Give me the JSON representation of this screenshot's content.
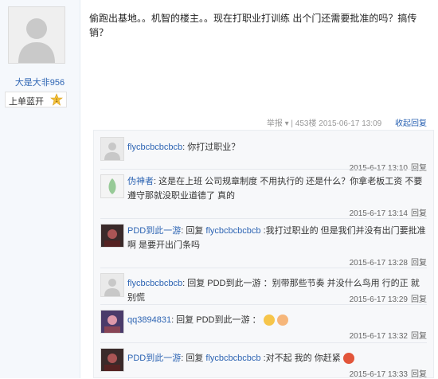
{
  "user": {
    "name": "大是大非956",
    "level_label": "上单蓝开"
  },
  "post": {
    "text": "偷跑出基地。。机智的楼主。。现在打职业打训练 出个门还需要批准的吗？搞传销？"
  },
  "meta": {
    "info": "举报 ▾ | 453楼  2015-06-17 13:09",
    "reply_label": "收起回复"
  },
  "replies": [
    {
      "user": "flycbcbcbcbcb",
      "sep": ":",
      "text": " 你打过职业？",
      "time": "2015-6-17 13:10",
      "reply_btn": "回复"
    },
    {
      "user": "伪神者",
      "sep": ":",
      "text": " 这是在上班 公司规章制度 不用执行的 还是什么？你拿老板工资 不要遵守那就没职业道德了 真的",
      "time": "2015-6-17 13:14",
      "reply_btn": "回复"
    },
    {
      "user": "PDD到此一游",
      "sep": ":",
      "prefix": " 回复 ",
      "target": "flycbcbcbcbcb",
      "text": " :我打过职业的 但是我们并没有出门要批准啊 是要开出门条吗",
      "time": "2015-6-17 13:28",
      "reply_btn": "回复"
    },
    {
      "user": "flycbcbcbcbcb",
      "sep": ":",
      "prefix": " 回复 ",
      "target_plain": "PDD到此一游",
      "text": " ：别带那些节奏 并没什么鸟用 行的正 就别慌",
      "time": "2015-6-17 13:29",
      "reply_btn": "回复"
    },
    {
      "user": "qq3894831",
      "sep": ":",
      "prefix": " 回复 ",
      "target_plain": "PDD到此一游",
      "text": " ：",
      "time": "2015-6-17 13:32",
      "reply_btn": "回复"
    },
    {
      "user": "PDD到此一游",
      "sep": ":",
      "prefix": " 回复 ",
      "target": "flycbcbcbcbcb",
      "text": " :对不起 我的 你赶紧",
      "time": "2015-6-17 13:33",
      "reply_btn": "回复"
    }
  ]
}
